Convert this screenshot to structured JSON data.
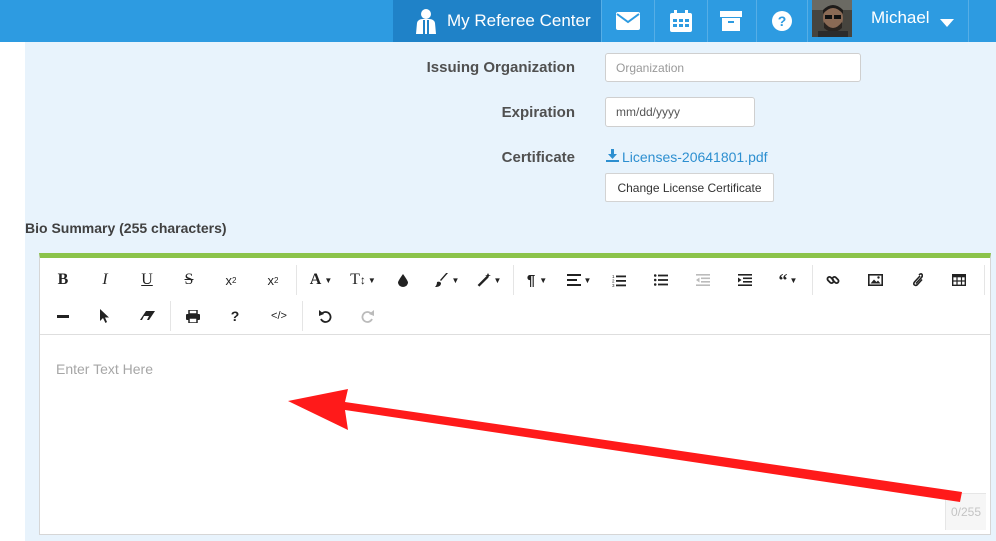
{
  "nav": {
    "referee_center_label": "My Referee Center",
    "user_name": "Michael",
    "accent": "#2d9be1",
    "active": "#1f82c8",
    "icons": [
      "referee-icon",
      "envelope-icon",
      "calendar-icon",
      "archive-icon",
      "help-icon"
    ]
  },
  "form": {
    "issuing_org_label": "Issuing Organization",
    "issuing_org_placeholder": "Organization",
    "expiration_label": "Expiration",
    "expiration_placeholder": "mm/dd/yyyy",
    "certificate_label": "Certificate",
    "certificate_file": "Licenses-20641801.pdf",
    "change_button": "Change License Certificate"
  },
  "bio": {
    "label": "Bio Summary (255 characters)",
    "placeholder": "Enter Text Here",
    "counter": "0/255",
    "toolbar_row1": [
      "bold",
      "italic",
      "underline",
      "strikethrough",
      "subscript",
      "superscript",
      "font-family",
      "font-size",
      "color",
      "brush",
      "magic",
      "paragraph",
      "align",
      "ordered-list",
      "unordered-list",
      "outdent",
      "indent",
      "quote",
      "link",
      "image",
      "attachment",
      "table"
    ],
    "toolbar_row2": [
      "horizontal-rule",
      "select",
      "eraser",
      "print",
      "help",
      "code-view",
      "undo",
      "redo"
    ],
    "top_border_color": "#8bc34a"
  },
  "annotation": {
    "arrow_color": "#ff1a1a"
  }
}
